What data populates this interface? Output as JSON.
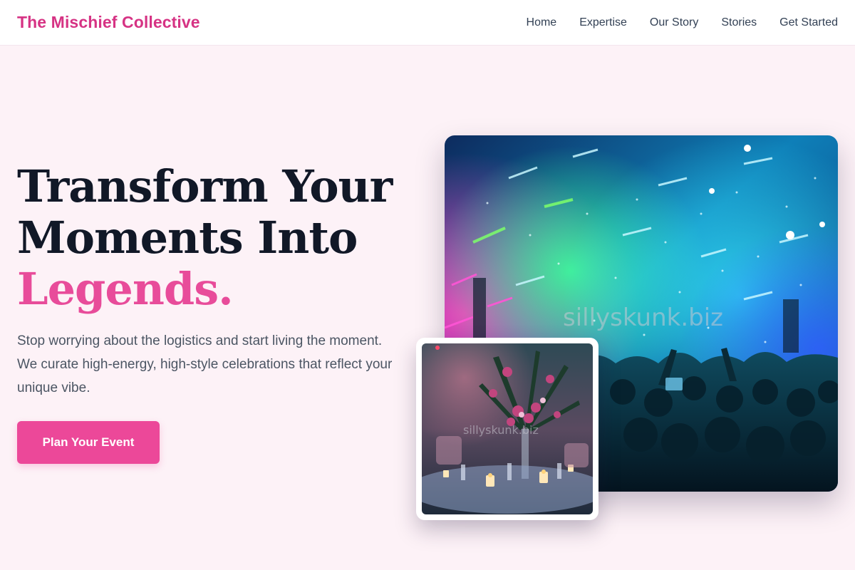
{
  "nav": {
    "brand": "The Mischief Collective",
    "links": [
      {
        "label": "Home"
      },
      {
        "label": "Expertise"
      },
      {
        "label": "Our Story"
      },
      {
        "label": "Stories"
      },
      {
        "label": "Get Started"
      }
    ]
  },
  "hero": {
    "headline_line1": "Transform Your",
    "headline_line2": "Moments Into",
    "headline_accent": "Legends.",
    "subtext": "Stop worrying about the logistics and start living the moment. We curate high-energy, high-style celebrations that reflect your unique vibe.",
    "cta_label": "Plan Your Event"
  },
  "images": {
    "main_watermark": "sillyskunk.biz",
    "inset_watermark": "sillyskunk.biz"
  },
  "colors": {
    "brand": "#d63384",
    "accent": "#e84c9a",
    "cta": "#ec4899",
    "page_bg": "#fdf2f7"
  }
}
